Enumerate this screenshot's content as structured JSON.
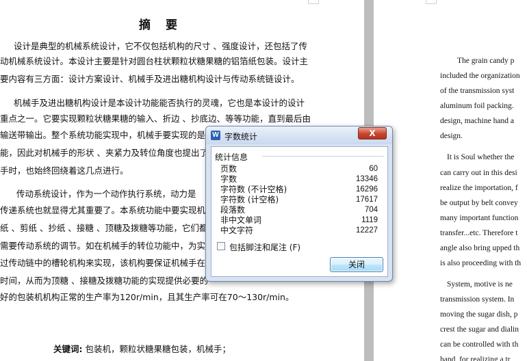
{
  "document": {
    "title": "摘  要",
    "lines": [
      "设计是典型的机械系统设计，它不仅包括机构的尺寸 、强度设计，还包括了传",
      "动机械系统设计。本设计主要是针对圆台柱状颗粒状糖果糖的铝箔纸包装。设计主",
      "要内容有三方面：设计方案设计、机械手及进出糖机构设计与传动系统链设计。",
      "机械手及进出糖机构设计是本设计功能能否执行的灵魂，它也是本设计的设计",
      "重点之一。它要实现颗粒状糖果糖的输入、折边 、抄底边、等等功能，直到最后由",
      "输送带输出。整个系统功能实现中，机械手要实现的是",
      "能，因此对机械手的形状 、夹紧力及转位角度也提出了",
      "手时，也始终回绕着这几点进行。",
      "传动系统设计，作为一个动作执行系统，动力是",
      "传递系统也就显得尤其重要了。本系统功能中要实现机",
      "纸 、剪纸 、抄纸 、接糖 、顶糖及拨糖等功能，它们都靠",
      "需要传动系统的调节。如在机械手的转位功能中，为实",
      "过传动链中的槽轮机构来实现，该机构要保证机械手在",
      "时间，从而为顶糖 、接糖及拨糖功能的实现提供必要的",
      "好的包装机机构正常的生产率为120r/min，且其生产率可在70～130r/min。"
    ],
    "keywords_label": "关键词:",
    "keywords": "包装机，颗粒状糖果糖包装，机械手；",
    "english_lines": [
      "The grain candy p",
      "included the organization",
      "of the transmission syst",
      "aluminum foil packing.",
      "design, machine hand a",
      "design.",
      "It is Soul whether the",
      "can carry out in this desi",
      "realize the importation, f",
      "be output by belt convey",
      "many important function",
      "transfer...etc. Therefore t",
      "angle also bring upped th",
      "is also proceeding with th",
      "System, motive is ne",
      "transmission system. In",
      "moving the sugar dish, p",
      "crest the sugar and dialin",
      "can be controlled with th",
      "hand, for realizing a tr"
    ]
  },
  "dialog": {
    "icon": "W",
    "title": "字数统计",
    "close_x": "X",
    "group_label": "统计信息",
    "stats": [
      {
        "label": "页数",
        "value": "60"
      },
      {
        "label": "字数",
        "value": "13346"
      },
      {
        "label": "字符数 (不计空格)",
        "value": "16296"
      },
      {
        "label": "字符数 (计空格)",
        "value": "17617"
      },
      {
        "label": "段落数",
        "value": "704"
      },
      {
        "label": "非中文单词",
        "value": "1119"
      },
      {
        "label": "中文字符",
        "value": "12227"
      }
    ],
    "checkbox_label": "包括脚注和尾注 (F)",
    "checkbox_checked": false,
    "close_button": "关闭"
  },
  "colors": {
    "gutter": "#bdbdbd",
    "dialog_frame": "#d7e3f2",
    "close_x_red": "#c8452f"
  }
}
